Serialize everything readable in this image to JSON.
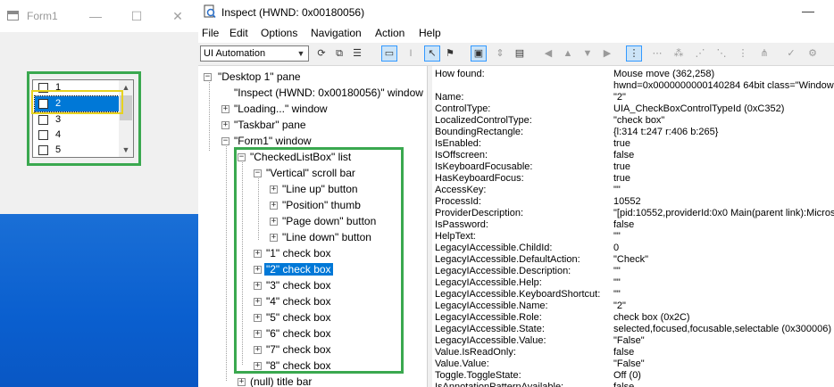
{
  "form1": {
    "title": "Form1",
    "caption_buttons": [
      "—",
      "☐",
      "✕"
    ],
    "list_items": [
      "1",
      "2",
      "3",
      "4",
      "5"
    ],
    "selected_item": "2",
    "scroll_up_icon": "▲",
    "scroll_down_icon": "▼"
  },
  "inspect": {
    "title": "Inspect  (HWND: 0x00180056)",
    "minimize": "—",
    "menu": [
      "File",
      "Edit",
      "Options",
      "Navigation",
      "Action",
      "Help"
    ],
    "mode": "UI Automation",
    "mode_arrow": "▼",
    "toolbar_icons": [
      "⟳",
      "⧉",
      "☰",
      "▭",
      "I",
      "↖",
      "⚑",
      "▣",
      "⇕",
      "▤",
      "◀",
      "▲",
      "▼",
      "▶",
      "⋮",
      "⋯",
      "⁂",
      "⋰",
      "⋱",
      "⋮",
      "⋔",
      "✓",
      "⚙"
    ],
    "tree": [
      {
        "label": "\"Desktop 1\" pane",
        "sign": "−"
      },
      {
        "label": "\"Inspect  (HWND: 0x00180056)\" window",
        "sign": ""
      },
      {
        "label": "\"Loading...\" window",
        "sign": "+"
      },
      {
        "label": "\"Taskbar\" pane",
        "sign": "+"
      },
      {
        "label": "\"Form1\" window",
        "sign": "−"
      },
      {
        "label": "\"CheckedListBox\" list",
        "sign": "−"
      },
      {
        "label": "\"Vertical\" scroll bar",
        "sign": "−"
      },
      {
        "label": "\"Line up\" button",
        "sign": "+"
      },
      {
        "label": "\"Position\" thumb",
        "sign": "+"
      },
      {
        "label": "\"Page down\" button",
        "sign": "+"
      },
      {
        "label": "\"Line down\" button",
        "sign": "+"
      },
      {
        "label": "\"1\" check box",
        "sign": "+"
      },
      {
        "label": "\"2\" check box",
        "sign": "+"
      },
      {
        "label": "\"3\" check box",
        "sign": "+"
      },
      {
        "label": "\"4\" check box",
        "sign": "+"
      },
      {
        "label": "\"5\" check box",
        "sign": "+"
      },
      {
        "label": "\"6\" check box",
        "sign": "+"
      },
      {
        "label": "\"7\" check box",
        "sign": "+"
      },
      {
        "label": "\"8\" check box",
        "sign": "+"
      },
      {
        "label": "(null) title bar",
        "sign": "+"
      }
    ],
    "properties": [
      {
        "name": "How found:",
        "value": "Mouse move (362,258)"
      },
      {
        "name": "",
        "value": "hwnd=0x0000000000140284 64bit class=\"Windows"
      },
      {
        "name": "Name:",
        "value": "\"2\""
      },
      {
        "name": "ControlType:",
        "value": "UIA_CheckBoxControlTypeId (0xC352)"
      },
      {
        "name": "LocalizedControlType:",
        "value": "\"check box\""
      },
      {
        "name": "BoundingRectangle:",
        "value": "{l:314 t:247 r:406 b:265}"
      },
      {
        "name": "IsEnabled:",
        "value": "true"
      },
      {
        "name": "IsOffscreen:",
        "value": "false"
      },
      {
        "name": "IsKeyboardFocusable:",
        "value": "true"
      },
      {
        "name": "HasKeyboardFocus:",
        "value": "true"
      },
      {
        "name": "AccessKey:",
        "value": "\"\""
      },
      {
        "name": "ProcessId:",
        "value": "10552"
      },
      {
        "name": "ProviderDescription:",
        "value": "\"[pid:10552,providerId:0x0 Main(parent link):Microsc"
      },
      {
        "name": "IsPassword:",
        "value": "false"
      },
      {
        "name": "HelpText:",
        "value": "\"\""
      },
      {
        "name": "LegacyIAccessible.ChildId:",
        "value": "0"
      },
      {
        "name": "LegacyIAccessible.DefaultAction:",
        "value": "\"Check\""
      },
      {
        "name": "LegacyIAccessible.Description:",
        "value": "\"\""
      },
      {
        "name": "LegacyIAccessible.Help:",
        "value": "\"\""
      },
      {
        "name": "LegacyIAccessible.KeyboardShortcut:",
        "value": "\"\""
      },
      {
        "name": "LegacyIAccessible.Name:",
        "value": "\"2\""
      },
      {
        "name": "LegacyIAccessible.Role:",
        "value": "check box (0x2C)"
      },
      {
        "name": "LegacyIAccessible.State:",
        "value": "selected,focused,focusable,selectable (0x300006)"
      },
      {
        "name": "LegacyIAccessible.Value:",
        "value": "\"False\""
      },
      {
        "name": "Value.IsReadOnly:",
        "value": "false"
      },
      {
        "name": "Value.Value:",
        "value": "\"False\""
      },
      {
        "name": "Toggle.ToggleState:",
        "value": "Off (0)"
      },
      {
        "name": "IsAnnotationPatternAvailable:",
        "value": "false"
      }
    ]
  },
  "colors": {
    "selection": "#0078d7",
    "highlight_green": "#3aa84f",
    "focus_yellow": "#e6d21f",
    "desktop_blue": "#0a5fcf"
  }
}
